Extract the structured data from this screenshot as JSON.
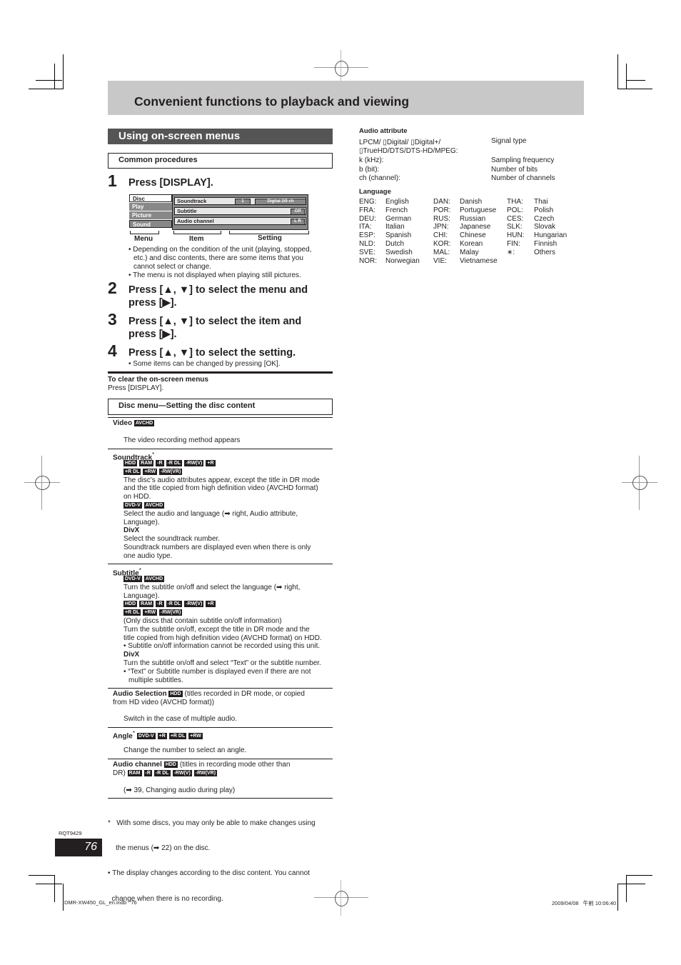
{
  "page": {
    "title": "Convenient functions to playback and viewing",
    "section_title": "Using on-screen menus",
    "common_procedures_label": "Common procedures",
    "page_number": "76",
    "doc_code": "RQT9429",
    "footer_file": "DMR-XW450_GL_en.indb   76",
    "footer_timestamp": "2009/04/08   午前 10:06:40"
  },
  "steps": [
    {
      "num": "1",
      "text": "Press [DISPLAY]."
    },
    {
      "num": "2",
      "text_line1": "Press [▲, ▼] to select the menu and",
      "text_line2": "press [▶]."
    },
    {
      "num": "3",
      "text_line1": "Press [▲, ▼] to select the item and",
      "text_line2": "press [▶]."
    },
    {
      "num": "4",
      "text": "Press [▲, ▼] to select the setting.",
      "note": "• Some items can be changed by pressing [OK]."
    }
  ],
  "osd": {
    "menus": [
      "Disc",
      "Play",
      "Picture",
      "Sound"
    ],
    "items": [
      {
        "label": "Soundtrack",
        "value1": "1",
        "value2": "Digital  2/0 ch"
      },
      {
        "label": "Subtitle",
        "value": "Off"
      },
      {
        "label": "Audio channel",
        "value": "L R"
      }
    ],
    "captions": {
      "menu": "Menu",
      "item": "Item",
      "setting": "Setting"
    }
  },
  "step1_notes": [
    "• Depending on the condition of the unit (playing, stopped,",
    "etc.) and disc contents, there are some items that you",
    "cannot select or change.",
    "• The menu is not displayed when playing still pictures."
  ],
  "clear": {
    "title": "To clear the on-screen menus",
    "text": "Press [DISPLAY]."
  },
  "disc_menu": {
    "label": "Disc menu—Setting the disc content",
    "video": {
      "title": "Video",
      "badges": [
        "AVCHD"
      ],
      "text": "The video recording method appears"
    },
    "soundtrack": {
      "title": "Soundtrack",
      "mark": "*",
      "badges_row1": [
        "HDD",
        "RAM",
        "-R",
        "-R DL",
        "-RW(V)",
        "+R"
      ],
      "badges_row2": [
        "+R DL",
        "+RW",
        "-RW(VR)"
      ],
      "text1": [
        "The disc's audio attributes appear, except the title in DR mode",
        "and the title copied from high definition video (AVCHD format)",
        "on HDD."
      ],
      "badges_row3": [
        "DVD-V",
        "AVCHD"
      ],
      "text2": [
        "Select the audio and language (➡ right, Audio attribute,",
        "Language)."
      ],
      "divx_label": "DivX",
      "text3": [
        "Select the soundtrack number.",
        "Soundtrack numbers are displayed even when there is only",
        "one audio type."
      ]
    },
    "subtitle": {
      "title": "Subtitle",
      "mark": "*",
      "badges_row1": [
        "DVD-V",
        "AVCHD"
      ],
      "text1": [
        "Turn the subtitle on/off and select the language (➡ right,",
        "Language)."
      ],
      "badges_row2": [
        "HDD",
        "RAM",
        "-R",
        "-R DL",
        "-RW(V)",
        "+R"
      ],
      "badges_row3": [
        "+R DL",
        "+RW",
        "-RW(VR)"
      ],
      "text2": [
        "(Only discs that contain subtitle on/off information)",
        "Turn the subtitle on/off, except the title in DR mode and the",
        "title copied from high definition video (AVCHD format) on HDD.",
        "• Subtitle on/off information cannot be recorded using this unit."
      ],
      "divx_label": "DivX",
      "text3": [
        "Turn the subtitle on/off and select “Text” or the subtitle number.",
        "• “Text” or Subtitle number is displayed even if there are not",
        "  multiple subtitles."
      ]
    },
    "audio_selection": {
      "title": "Audio Selection",
      "badge": "HDD",
      "after": "(titles recorded in DR mode, or copied",
      "line2": "from HD video (AVCHD format))",
      "text": "Switch in the case of multiple audio."
    },
    "angle": {
      "title": "Angle",
      "mark": "*",
      "badges": [
        "DVD-V",
        "+R",
        "+R DL",
        "+RW"
      ],
      "text": "Change the number to select an angle."
    },
    "audio_channel": {
      "title": "Audio channel",
      "badge": "HDD",
      "after": "(titles in recording mode other than",
      "line2_prefix": "DR)",
      "badges_line2": [
        "RAM",
        "-R",
        "-R DL",
        "-RW(V)",
        "-RW(VR)"
      ],
      "text": "(➡ 39, Changing audio during play)"
    }
  },
  "footnotes": [
    "*   With some discs, you may only be able to make changes using",
    "    the menus (➡ 22) on the disc.",
    "• The display changes according to the disc content. You cannot",
    "  change when there is no recording."
  ],
  "audio_attribute": {
    "title": "Audio attribute",
    "rows": [
      {
        "key": "LPCM/ ▯Digital/ ▯Digital+/",
        "value": "Signal type"
      },
      {
        "key": "▯TrueHD/DTS/DTS-HD/MPEG:",
        "value": ""
      },
      {
        "key": "k (kHz):",
        "value": "Sampling frequency"
      },
      {
        "key": "b (bit):",
        "value": "Number of bits"
      },
      {
        "key": "ch (channel):",
        "value": "Number of channels"
      }
    ]
  },
  "language": {
    "title": "Language",
    "columns": [
      [
        {
          "code": "ENG:",
          "name": "English"
        },
        {
          "code": "FRA:",
          "name": "French"
        },
        {
          "code": "DEU:",
          "name": "German"
        },
        {
          "code": "ITA:",
          "name": "Italian"
        },
        {
          "code": "ESP:",
          "name": "Spanish"
        },
        {
          "code": "NLD:",
          "name": "Dutch"
        },
        {
          "code": "SVE:",
          "name": "Swedish"
        },
        {
          "code": "NOR:",
          "name": "Norwegian"
        }
      ],
      [
        {
          "code": "DAN:",
          "name": "Danish"
        },
        {
          "code": "POR:",
          "name": "Portuguese"
        },
        {
          "code": "RUS:",
          "name": "Russian"
        },
        {
          "code": "JPN:",
          "name": "Japanese"
        },
        {
          "code": "CHI:",
          "name": "Chinese"
        },
        {
          "code": "KOR:",
          "name": "Korean"
        },
        {
          "code": "MAL:",
          "name": "Malay"
        },
        {
          "code": "VIE:",
          "name": "Vietnamese"
        }
      ],
      [
        {
          "code": "THA:",
          "name": "Thai"
        },
        {
          "code": "POL:",
          "name": "Polish"
        },
        {
          "code": "CES:",
          "name": "Czech"
        },
        {
          "code": "SLK:",
          "name": "Slovak"
        },
        {
          "code": "HUN:",
          "name": "Hungarian"
        },
        {
          "code": "FIN:",
          "name": "Finnish"
        },
        {
          "code": "∗:",
          "name": "Others"
        }
      ]
    ]
  }
}
